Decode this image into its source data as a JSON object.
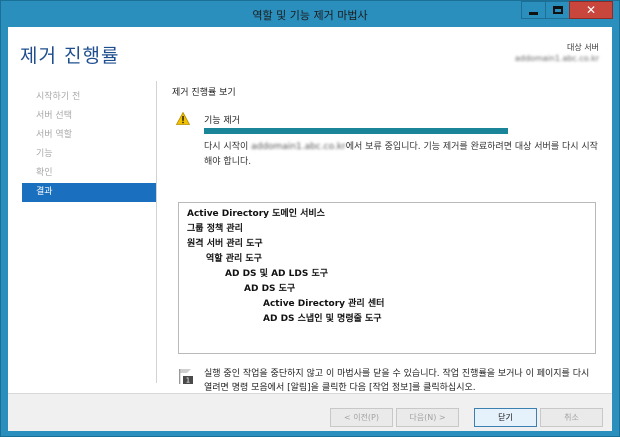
{
  "window": {
    "title": "역할 및 기능 제거 마법사",
    "minimize_glyph": "",
    "close_glyph": "✕"
  },
  "header": {
    "page_title": "제거 진행률",
    "destination_label": "대상 서버",
    "destination_value": "addomain1.abc.co.kr"
  },
  "nav": {
    "items": [
      {
        "label": "시작하기 전",
        "active": false
      },
      {
        "label": "서버 선택",
        "active": false
      },
      {
        "label": "서버 역할",
        "active": false
      },
      {
        "label": "기능",
        "active": false
      },
      {
        "label": "확인",
        "active": false
      },
      {
        "label": "결과",
        "active": true
      }
    ]
  },
  "content": {
    "section_title": "제거 진행률 보기",
    "status_label": "기능 제거",
    "progress": 1.0,
    "status_msg_prefix": "다시 시작이 ",
    "status_msg_server": "addomain1.abc.co.kr",
    "status_msg_suffix": "에서 보류 중입니다. 기능 제거를 완료하려면 대상 서버를 다시 시작해야 합니다.",
    "features": [
      {
        "label": "Active Directory 도메인 서비스",
        "level": 0
      },
      {
        "label": "그룹 정책 관리",
        "level": 0
      },
      {
        "label": "원격 서버 관리 도구",
        "level": 0
      },
      {
        "label": "역할 관리 도구",
        "level": 1
      },
      {
        "label": "AD DS 및 AD LDS 도구",
        "level": 2
      },
      {
        "label": "AD DS 도구",
        "level": 3
      },
      {
        "label": "Active Directory 관리 센터",
        "level": 4
      },
      {
        "label": "AD DS 스냅인 및 명령줄 도구",
        "level": 4
      }
    ],
    "note": "실행 중인 작업을 중단하지 않고 이 마법사를 닫을 수 있습니다. 작업 진행률을 보거나 이 페이지를 다시 열려면 명령 모음에서 [알림]을 클릭한 다음 [작업 정보]를 클릭하십시오.",
    "note_badge": "1"
  },
  "footer": {
    "prev_label": "< 이전(P)",
    "next_label": "다음(N) >",
    "close_label": "닫기",
    "cancel_label": "취소"
  },
  "colors": {
    "accent": "#1b6fbf",
    "progress": "#1a8599",
    "title": "#1f4e8e",
    "frame": "#2a8fbd"
  }
}
